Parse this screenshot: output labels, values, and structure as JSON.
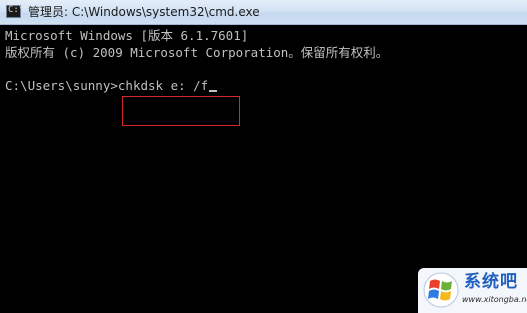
{
  "window": {
    "title": "管理员: C:\\Windows\\system32\\cmd.exe",
    "icon": "cmd-icon"
  },
  "console": {
    "lines": [
      "Microsoft Windows [版本 6.1.7601]",
      "版权所有 (c) 2009 Microsoft Corporation。保留所有权利。",
      ""
    ],
    "prompt": "C:\\Users\\sunny>",
    "command": "chkdsk e: /f",
    "text_color": "#c0c0c0",
    "background": "#000000"
  },
  "annotation": {
    "highlight_color": "#d8282b"
  },
  "watermark": {
    "brand": "系统吧",
    "url": "www.xitongba.net"
  }
}
